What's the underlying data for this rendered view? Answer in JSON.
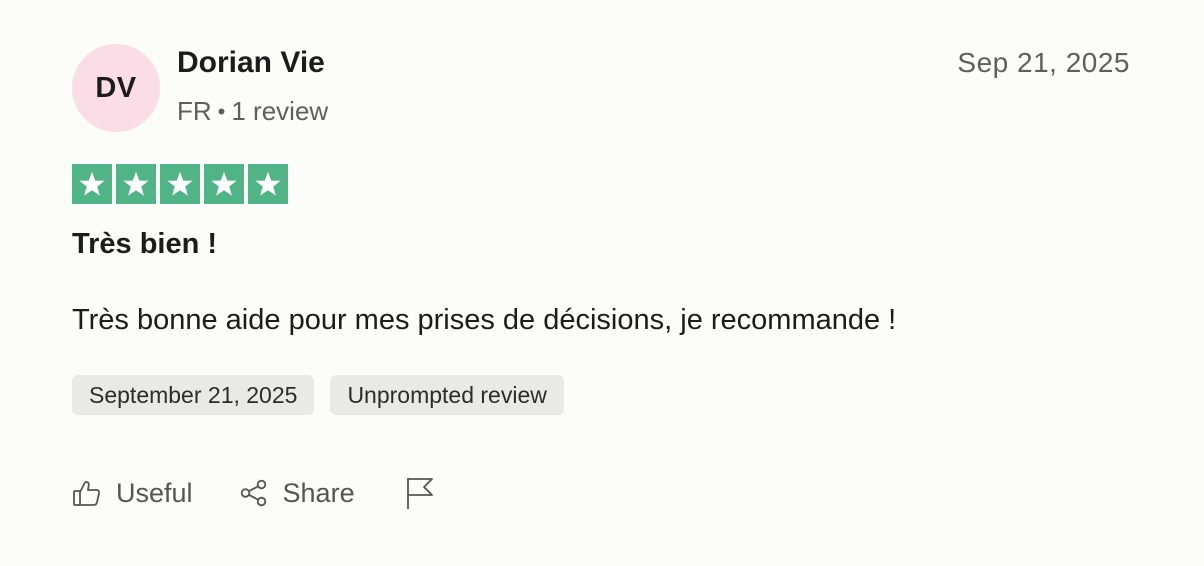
{
  "reviewer": {
    "initials": "DV",
    "name": "Dorian Vie",
    "country": "FR",
    "separator": "•",
    "review_count": "1 review"
  },
  "review": {
    "date_short": "Sep 21, 2025",
    "rating": 5,
    "rating_max": 5,
    "title": "Très bien !",
    "body": "Très bonne aide pour mes prises de décisions, je recommande !",
    "tags": [
      "September 21, 2025",
      "Unprompted review"
    ]
  },
  "actions": {
    "useful_label": "Useful",
    "share_label": "Share"
  },
  "colors": {
    "star_green": "#51b487",
    "avatar_bg": "#fbdde7",
    "tag_bg": "#e9e9e8"
  },
  "icons": [
    "star-icon",
    "thumbs-up-icon",
    "share-icon",
    "flag-icon"
  ]
}
